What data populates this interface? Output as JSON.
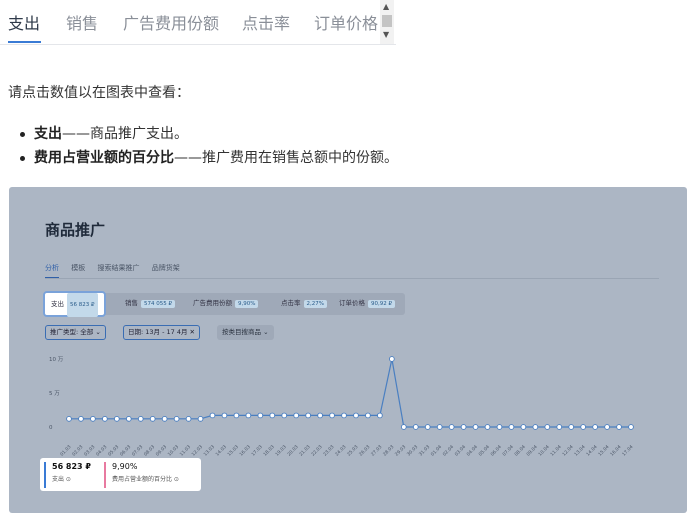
{
  "tabs": [
    {
      "label": "支出",
      "active": true
    },
    {
      "label": "销售",
      "active": false
    },
    {
      "label": "广告费用份额",
      "active": false
    },
    {
      "label": "点击率",
      "active": false
    },
    {
      "label": "订单价格",
      "active": false
    }
  ],
  "intro": "请点击数值以在图表中查看：",
  "bullets": [
    {
      "bold": "支出",
      "text": "——商品推广支出。"
    },
    {
      "bold": "费用占营业额的百分比",
      "text": "——推广费用在销售总额中的份额。"
    }
  ],
  "screenshot": {
    "title": "商品推广",
    "subtabs": [
      "分析",
      "模板",
      "搜索结果推广",
      "品牌货架"
    ],
    "metrics": [
      {
        "label": "支出",
        "value": "56 823 ₽",
        "active": true
      },
      {
        "label": "销售",
        "value": "574 055 ₽",
        "active": false
      },
      {
        "label": "广告费用份额",
        "value": "9,90%",
        "active": false
      },
      {
        "label": "点击率",
        "value": "2,27%",
        "active": false
      },
      {
        "label": "订单价格",
        "value": "90,92 ₽",
        "active": false
      }
    ],
    "filters": {
      "type": "推广类型: 全部 ⌄",
      "date": "日期: 13月 - 17 4月 ✕",
      "product": "按类目搜商品 ⌄"
    },
    "summary": [
      {
        "value": "56 823 ₽",
        "label": "支出 ⊙",
        "color": "#3a7bd5"
      },
      {
        "value": "9,90%",
        "label": "费用占营业额的百分比 ⊙",
        "color": "#e87aa0"
      }
    ]
  },
  "chart_data": {
    "type": "line",
    "yticks": [
      "10 万",
      "5 万",
      "0"
    ],
    "ylim": [
      0,
      100000
    ],
    "x": [
      "01.03",
      "02.03",
      "03.03",
      "04.03",
      "05.03",
      "06.03",
      "07.03",
      "08.03",
      "09.03",
      "10.03",
      "11.03",
      "12.03",
      "13.03",
      "14.03",
      "15.03",
      "16.03",
      "17.03",
      "18.03",
      "19.03",
      "20.03",
      "21.03",
      "22.03",
      "23.03",
      "24.03",
      "25.03",
      "26.03",
      "27.03",
      "28.03",
      "29.03",
      "30.03",
      "31.03",
      "01.04",
      "02.04",
      "03.04",
      "04.04",
      "05.04",
      "06.04",
      "07.04",
      "08.04",
      "09.04",
      "10.04",
      "11.04",
      "12.04",
      "13.04",
      "14.04",
      "15.04",
      "16.04",
      "17.04"
    ],
    "values": [
      12000,
      12000,
      12000,
      12000,
      12000,
      12000,
      12000,
      12000,
      12000,
      12000,
      12000,
      12000,
      17000,
      17000,
      17000,
      17000,
      17000,
      17000,
      17000,
      17000,
      17000,
      17000,
      17000,
      17000,
      17000,
      17000,
      17000,
      100000,
      0,
      0,
      0,
      0,
      0,
      0,
      0,
      0,
      0,
      0,
      0,
      0,
      0,
      0,
      0,
      0,
      0,
      0,
      0,
      0
    ],
    "line_color": "#4a7fc1",
    "grid": false
  }
}
